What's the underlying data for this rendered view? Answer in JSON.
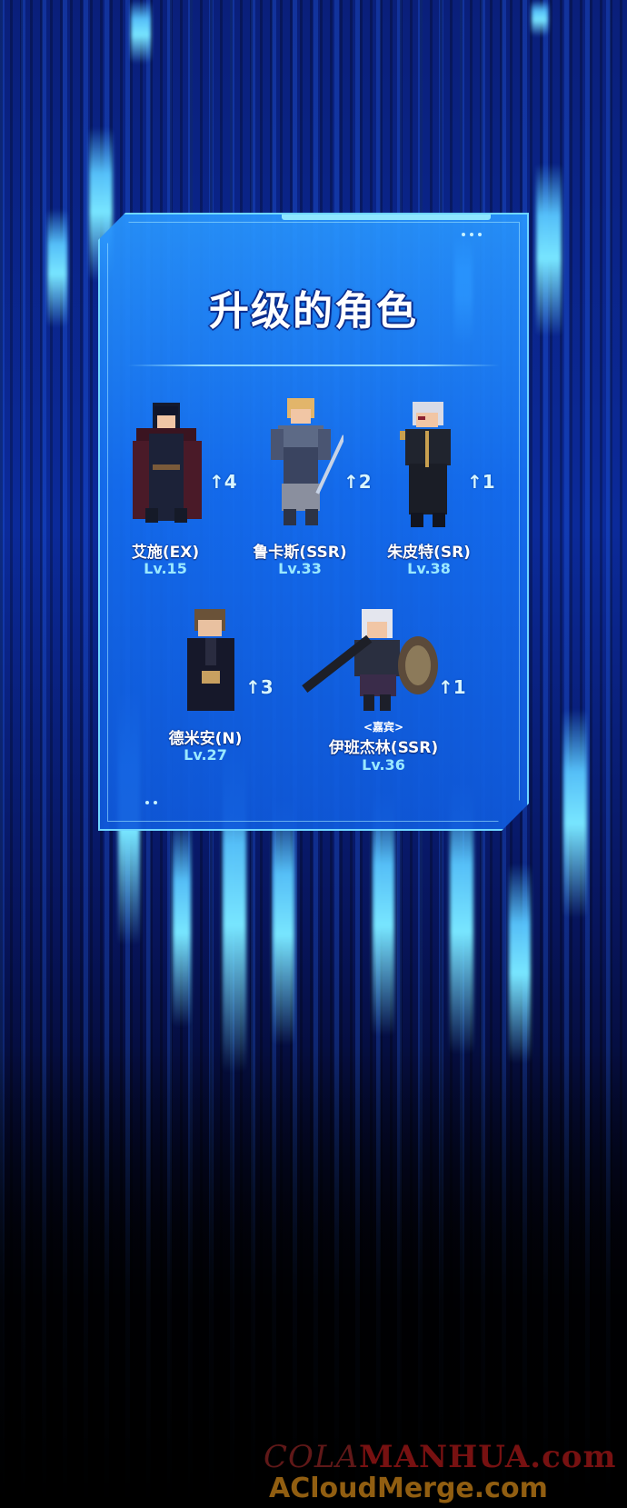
{
  "panel": {
    "title": "升级的角色"
  },
  "characters": [
    {
      "name": "艾施(EX)",
      "level": "Lv.15",
      "upgrade": "↑4",
      "sprite": "dark-haired-cloaked-swordsman-sprite"
    },
    {
      "name": "鲁卡斯(SSR)",
      "level": "Lv.33",
      "upgrade": "↑2",
      "sprite": "blond-armored-knight-sprite"
    },
    {
      "name": "朱皮特(SR)",
      "level": "Lv.38",
      "upgrade": "↑1",
      "sprite": "white-haired-officer-sprite"
    },
    {
      "name": "德米安(N)",
      "level": "Lv.27",
      "upgrade": "↑3",
      "sprite": "brown-haired-robed-mage-sprite"
    },
    {
      "name": "伊班杰林(SSR)",
      "level": "Lv.36",
      "upgrade": "↑1",
      "title": "<嘉宾>",
      "sprite": "silver-haired-greatsword-knight-sprite"
    }
  ],
  "watermark": {
    "line1_prefix": "COLA",
    "line1_suffix": "MANHUA.com",
    "line2": "ACloudMerge.com"
  },
  "colors": {
    "panel_accent": "#6fd6ff",
    "level_text": "#9ae9ff",
    "background_top": "#0a1f7a"
  }
}
